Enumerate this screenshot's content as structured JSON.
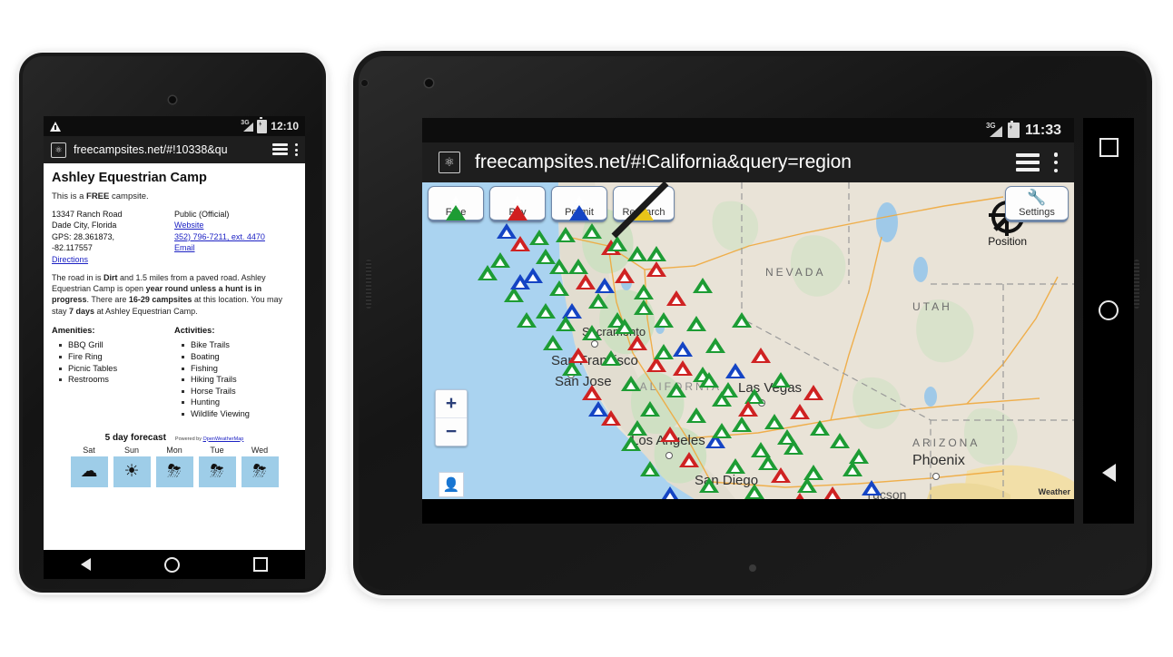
{
  "phone": {
    "status": {
      "warning_icon": "warning-triangle-icon",
      "network": "3G",
      "battery_icon": "battery-charging-icon",
      "time": "12:10"
    },
    "browser": {
      "site_icon": "site-favicon",
      "url": "freecampsites.net/#!10338&qu",
      "tabs_icon": "tab-stack-icon",
      "menu_icon": "overflow-menu-icon"
    },
    "page": {
      "title": "Ashley Equestrian Camp",
      "intro_pre": "This is a ",
      "intro_bold": "FREE",
      "intro_post": " campsite.",
      "address_lines": [
        "13347 Ranch Road",
        "Dade City, Florida",
        "GPS: 28.361873,",
        "-82.117557"
      ],
      "directions_link": "Directions",
      "ownership": "Public (Official)",
      "website_link": "Website",
      "phone_link": "352) 796-7211, ext. 4470",
      "email_link": "Email",
      "description": [
        {
          "t": "The road in is ",
          "b": false
        },
        {
          "t": "Dirt",
          "b": true
        },
        {
          "t": " and 1.5 miles from a paved road. Ashley Equestrian Camp is open ",
          "b": false
        },
        {
          "t": "year round unless a hunt is in progress",
          "b": true
        },
        {
          "t": ". There are ",
          "b": false
        },
        {
          "t": "16-29 campsites",
          "b": true
        },
        {
          "t": " at this location. You may stay ",
          "b": false
        },
        {
          "t": "7 days",
          "b": true
        },
        {
          "t": " at Ashley Equestrian Camp.",
          "b": false
        }
      ],
      "amenities_heading": "Amenities:",
      "amenities": [
        "BBQ Grill",
        "Fire Ring",
        "Picnic Tables",
        "Restrooms"
      ],
      "activities_heading": "Activities:",
      "activities": [
        "Bike Trails",
        "Boating",
        "Fishing",
        "Hiking Trails",
        "Horse Trails",
        "Hunting",
        "Wildlife Viewing"
      ],
      "forecast_title": "5 day forecast",
      "forecast_powered_pre": "Powered by ",
      "forecast_powered_link": "OpenWeatherMap",
      "forecast": [
        {
          "day": "Sat",
          "icon": "cloudy-icon",
          "glyph": "☁"
        },
        {
          "day": "Sun",
          "icon": "sunny-icon",
          "glyph": "☀"
        },
        {
          "day": "Mon",
          "icon": "rain-sun-icon",
          "glyph": "⛈"
        },
        {
          "day": "Tue",
          "icon": "rain-sun-icon",
          "glyph": "⛈"
        },
        {
          "day": "Wed",
          "icon": "rain-sun-icon",
          "glyph": "⛈"
        }
      ]
    },
    "nav": {
      "back": "back-button",
      "home": "home-button",
      "recents": "recents-button"
    }
  },
  "tablet": {
    "status": {
      "network": "3G",
      "battery_icon": "battery-charging-icon",
      "time": "11:33"
    },
    "browser": {
      "site_icon": "site-favicon",
      "url": "freecampsites.net/#!California&query=region",
      "tabs_icon": "tab-stack-icon",
      "menu_icon": "overflow-menu-icon"
    },
    "map": {
      "filters": [
        {
          "label": "Free",
          "color": "#1d9c34",
          "icon": "tent-triangle-green-icon",
          "disabled": false
        },
        {
          "label": "Pay",
          "color": "#d01f1f",
          "icon": "tent-triangle-red-icon",
          "disabled": false
        },
        {
          "label": "Permit",
          "color": "#1444c4",
          "icon": "tent-triangle-blue-icon",
          "disabled": false
        },
        {
          "label": "Research",
          "color": "#e8c419",
          "icon": "tent-triangle-yellow-icon",
          "disabled": true
        }
      ],
      "settings_label": "Settings",
      "settings_icon": "tools-gear-icon",
      "zoom_in": "+",
      "zoom_out": "−",
      "pegman_icon": "street-view-pegman-icon",
      "position_label": "Position",
      "position_icon": "crosshair-disabled-icon",
      "weather_badge": "Weather",
      "states": [
        "NEVADA",
        "UTAH",
        "ARIZONA",
        "CALIFORNIA"
      ],
      "cities": [
        "Sacramento",
        "San Francisco",
        "San Jose",
        "Las Vegas",
        "Los Angeles",
        "San Diego",
        "Phoenix",
        "Tucson"
      ],
      "legend_colors": {
        "free": "#1d9c34",
        "pay": "#cf2222",
        "permit": "#1444c4",
        "research": "#e8c419"
      }
    },
    "nav": {
      "recents": "recents-button",
      "home": "home-button",
      "back": "back-button"
    }
  }
}
